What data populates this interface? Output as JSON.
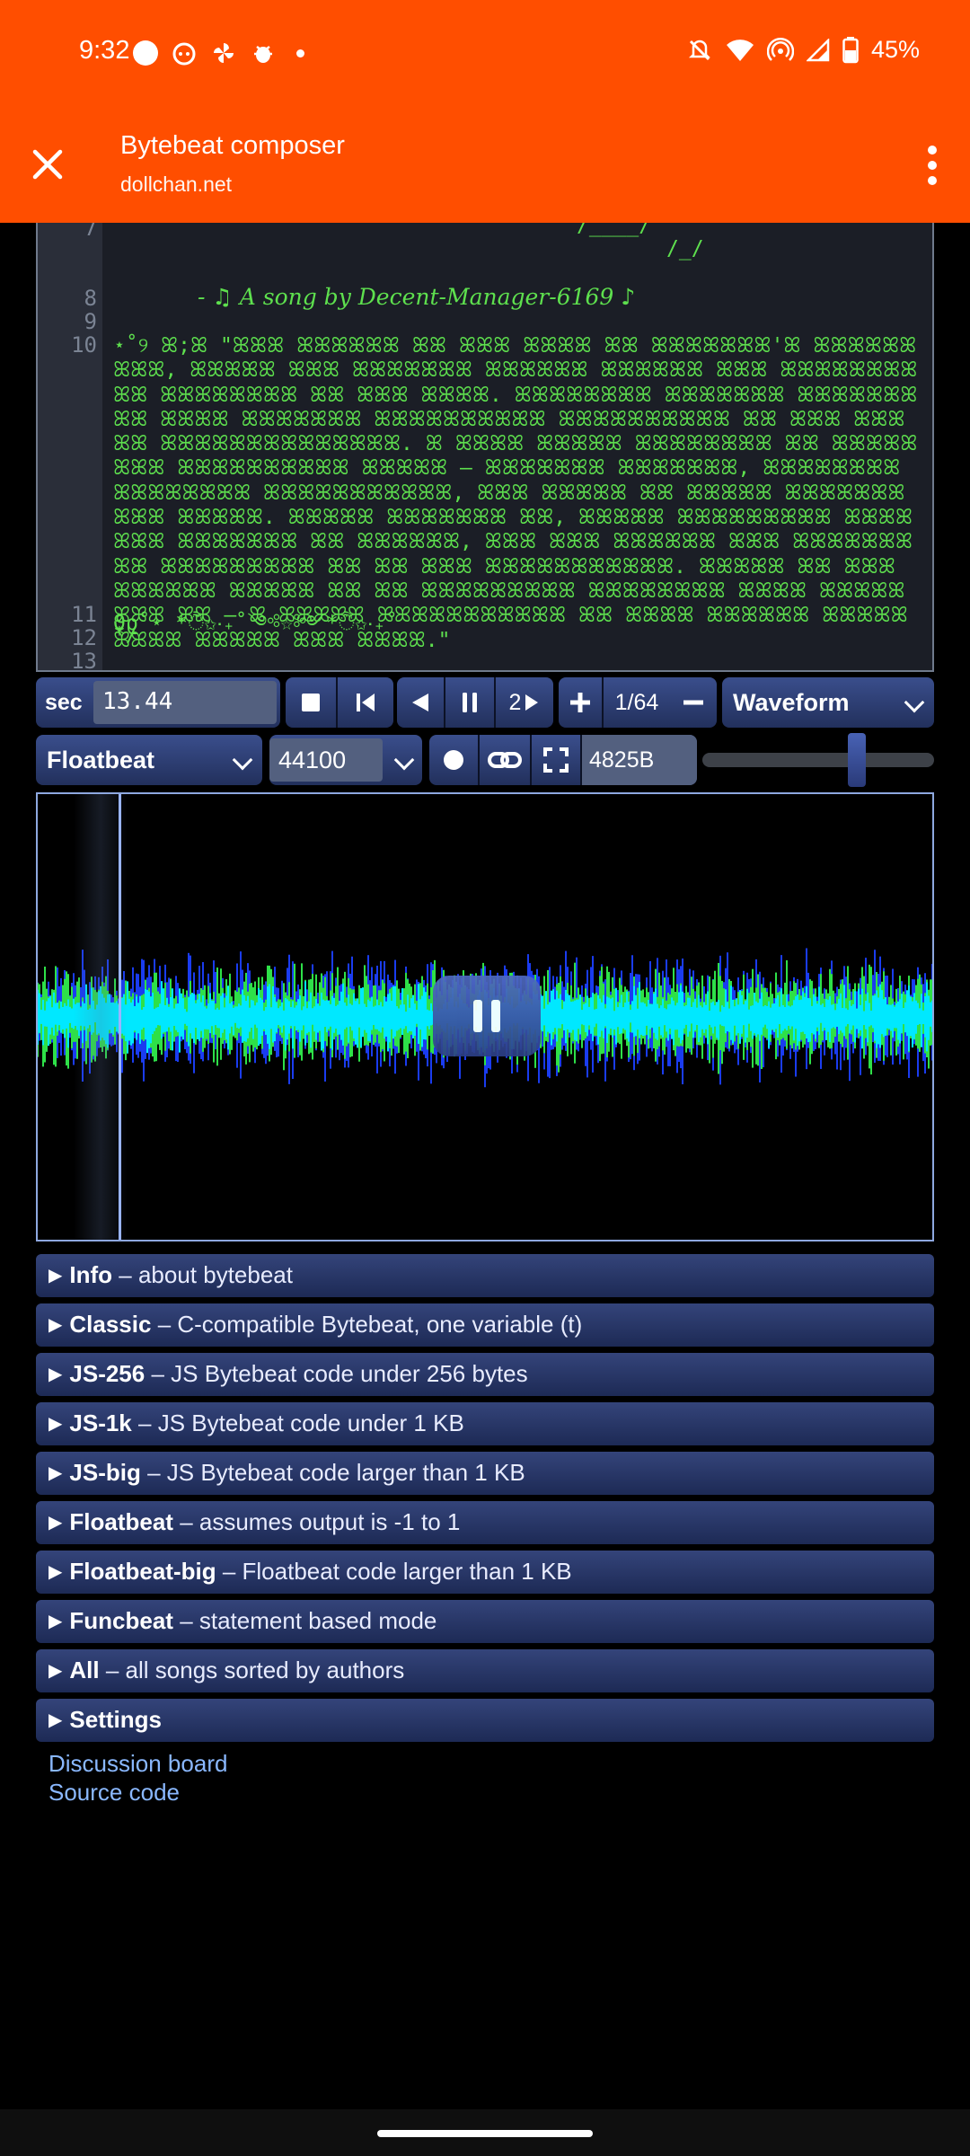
{
  "status_bar": {
    "time": "9:32",
    "battery": "45%"
  },
  "tab": {
    "title": "Bytebeat composer",
    "url": "dollchan.net"
  },
  "editor": {
    "line_numbers": [
      "7",
      "8",
      "9",
      "10",
      "11",
      "12",
      "13"
    ],
    "line7a": "/____/",
    "line7b": "/_/",
    "line8": "- ♫ A song by Decent-Manager-6169 ♪",
    "line10_text": "⋆˚୨ ꕤ;ꕤ \"ꕤꕤꕤ ꕤꕤꕤꕤꕤꕤ ꕤꕤ ꕤꕤꕤ ꕤꕤꕤꕤ ꕤꕤ ꕤꕤꕤꕤꕤꕤꕤ'ꕤ ꕤꕤꕤꕤꕤꕤꕤꕤꕤ, ꕤꕤꕤꕤꕤ ꕤꕤꕤ ꕤꕤꕤꕤꕤꕤꕤ ꕤꕤꕤꕤꕤꕤ ꕤꕤꕤꕤꕤꕤ ꕤꕤꕤ ꕤꕤꕤꕤꕤꕤꕤꕤꕤꕤ ꕤꕤꕤꕤꕤꕤꕤꕤ ꕤꕤ ꕤꕤꕤ ꕤꕤꕤꕤ. ꕤꕤꕤꕤꕤꕤꕤꕤ ꕤꕤꕤꕤꕤꕤꕤ ꕤꕤꕤꕤꕤꕤꕤꕤꕤ ꕤꕤꕤꕤ ꕤꕤꕤꕤꕤꕤꕤ ꕤꕤꕤꕤꕤꕤꕤꕤꕤꕤ ꕤꕤꕤꕤꕤꕤꕤꕤꕤꕤ ꕤꕤ ꕤꕤꕤ ꕤꕤꕤ ꕤꕤ ꕤꕤꕤꕤꕤꕤꕤꕤꕤꕤꕤꕤꕤꕤ. ꕤ ꕤꕤꕤꕤ ꕤꕤꕤꕤꕤ ꕤꕤꕤꕤꕤꕤꕤꕤ ꕤꕤ ꕤꕤꕤꕤꕤꕤꕤꕤ ꕤꕤꕤꕤꕤꕤꕤꕤꕤꕤ ꕤꕤꕤꕤꕤ — ꕤꕤꕤꕤꕤꕤꕤ ꕤꕤꕤꕤꕤꕤꕤ, ꕤꕤꕤꕤꕤꕤꕤꕤ ꕤꕤꕤꕤꕤꕤꕤꕤ ꕤꕤꕤꕤꕤꕤꕤꕤꕤꕤꕤ, ꕤꕤꕤ ꕤꕤꕤꕤꕤ ꕤꕤ ꕤꕤꕤꕤꕤ ꕤꕤꕤꕤꕤꕤꕤ ꕤꕤꕤ ꕤꕤꕤꕤꕤ. ꕤꕤꕤꕤꕤ ꕤꕤꕤꕤꕤꕤꕤ ꕤꕤ, ꕤꕤꕤꕤꕤ ꕤꕤꕤꕤꕤꕤꕤꕤꕤ ꕤꕤꕤꕤꕤꕤꕤ ꕤꕤꕤꕤꕤꕤꕤ ꕤꕤ ꕤꕤꕤꕤꕤꕤ, ꕤꕤꕤ ꕤꕤꕤ ꕤꕤꕤꕤꕤꕤ ꕤꕤꕤ ꕤꕤꕤꕤꕤꕤꕤꕤꕤ ꕤꕤꕤꕤꕤꕤꕤꕤꕤ ꕤꕤ ꕤꕤ ꕤꕤꕤ ꕤꕤꕤꕤꕤꕤꕤꕤꕤꕤꕤ. ꕤꕤꕤꕤꕤ ꕤꕤ ꕤꕤꕤ ꕤꕤꕤꕤꕤꕤ ꕤꕤꕤꕤꕤ ꕤꕤ ꕤꕤ ꕤꕤꕤꕤꕤꕤꕤꕤꕤ ꕤꕤꕤꕤꕤꕤꕤꕤ ꕤꕤꕤꕤ ꕤꕤꕤꕤꕤꕤꕤꕤ ꕤꕤ — ꕤ ꕤꕤꕤꕤꕤ ꕤꕤꕤꕤꕤꕤꕤꕤꕤꕤꕤ ꕤꕤ ꕤꕤꕤꕤ ꕤꕤꕤꕤꕤꕤ ꕤꕤꕤꕤꕤ ꕤꕤꕤꕤ ꕤꕤꕤꕤꕤ ꕤꕤꕤ ꕤꕤꕤꕤ.\"",
    "line11": "ϑϱ˚⋆ *ੈ✩‧₊˚༺☆༻*ੈ✩‧₊˚",
    "line12": "*/"
  },
  "controls": {
    "sec_label": "sec",
    "sec_value": "13.44",
    "speed_label": "2",
    "scale_label": "1/64",
    "display_mode": "Waveform",
    "mode": "Floatbeat",
    "sample_rate": "44100",
    "size_label": "4825B"
  },
  "volume": 0.68,
  "library": [
    {
      "name": "Info",
      "desc": " – about bytebeat"
    },
    {
      "name": "Classic",
      "desc": " – C-compatible Bytebeat, one variable (t)"
    },
    {
      "name": "JS-256",
      "desc": " – JS Bytebeat code under 256 bytes"
    },
    {
      "name": "JS-1k",
      "desc": " – JS Bytebeat code under 1 KB"
    },
    {
      "name": "JS-big",
      "desc": " – JS Bytebeat code larger than 1 KB"
    },
    {
      "name": "Floatbeat",
      "desc": " – assumes output is -1 to 1"
    },
    {
      "name": "Floatbeat-big",
      "desc": " – Floatbeat code larger than 1 KB"
    },
    {
      "name": "Funcbeat",
      "desc": " – statement based mode"
    },
    {
      "name": "All",
      "desc": " – all songs sorted by authors"
    },
    {
      "name": "Settings",
      "desc": ""
    }
  ],
  "links": {
    "discussion": "Discussion board",
    "source": "Source code"
  },
  "colors": {
    "header": "#ff4e00",
    "code_green": "#5ee04e",
    "wave_cyan": "#00e8ff",
    "wave_green": "#2ee048",
    "wave_blue": "#1a3cf0"
  }
}
